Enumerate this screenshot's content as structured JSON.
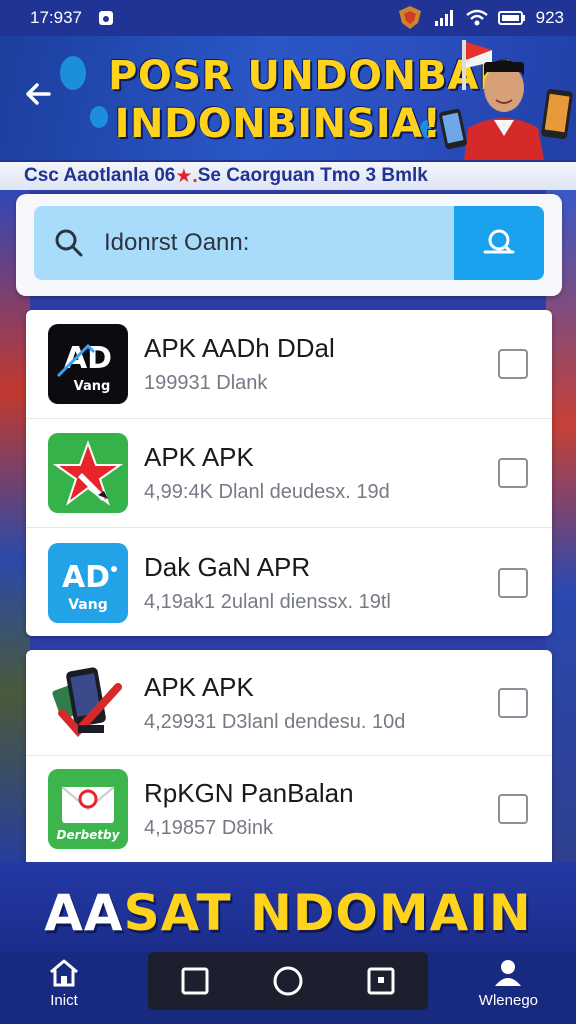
{
  "status_bar": {
    "time": "17:937",
    "battery": "923"
  },
  "header": {
    "banner_title_line1": "POSR UNDONBAN",
    "banner_title_line2": "INDONBINSIA!",
    "ticker_pre": "Csc Aaotlanla 06",
    "ticker_mark": "★.",
    "ticker_post": " Se Caorguan Tmo 3 Bmlk"
  },
  "search": {
    "placeholder": "Idonrst Oann:"
  },
  "apps": [
    {
      "name": "APK AADh DDal",
      "meta": "199931 Dlank",
      "icon": "ad-vang-black-icon"
    },
    {
      "name": "APK APK",
      "meta": "4,99:4K Dlanl deudesx. 19d",
      "icon": "red-star-green-icon"
    },
    {
      "name": "Dak GaN APR",
      "meta": "4,19ak1 2ulanl dienssx. 19tl",
      "icon": "ad-vang-blue-icon"
    }
  ],
  "apps_more": [
    {
      "name": "APK APK",
      "meta": "4,29931 D3lanl dendesu. 10d",
      "icon": "phone-check-icon"
    },
    {
      "name": "RpKGN PanBalan",
      "meta": "4,19857 D8ink",
      "icon": "envelope-green-icon"
    }
  ],
  "icon_labels": {
    "ad_vang_1_big": "AD",
    "ad_vang_1_small": "Vang",
    "ad_vang_2_big": "AD",
    "ad_vang_2_small": "Vang",
    "envelope_label": "Derbetby"
  },
  "bottom_banner": {
    "text_part1": "AA",
    "text_part2": "SAT NDOMAIN"
  },
  "bottom_nav": {
    "home_label": "Inict",
    "profile_label": "Wlenego"
  },
  "colors": {
    "accent_blue": "#1ba2ef",
    "banner_yellow": "#ffd21c",
    "header_blue": "#2a57c6"
  }
}
